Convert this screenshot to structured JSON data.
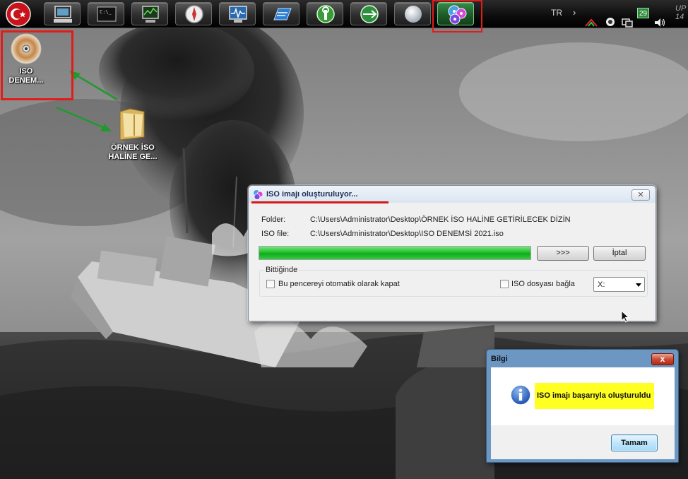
{
  "dock": {
    "items": [
      "start",
      "computer",
      "terminal",
      "system-monitor",
      "compass",
      "performance",
      "launch",
      "tools",
      "network",
      "ball",
      "iso-burner"
    ],
    "active_item": "iso-burner"
  },
  "tray": {
    "language": "TR",
    "badge_count": "29",
    "clock_line1": "UP",
    "clock_line2": "14"
  },
  "desktop": {
    "iso_icon_label_1": "ISO",
    "iso_icon_label_2": "DENEM...",
    "folder_label_1": "ÖRNEK İSO",
    "folder_label_2": "HALİNE GE..."
  },
  "iso_window": {
    "title": "ISO imajı oluşturuluyor...",
    "folder_label": "Folder:",
    "folder_value": "C:\\Users\\Administrator\\Desktop\\ÖRNEK İSO HALİNE GETİRİLECEK DİZİN",
    "iso_file_label": "ISO file:",
    "iso_file_value": "C:\\Users\\Administrator\\Desktop\\ISO DENEMSİ 2021.iso",
    "progress": 1.0,
    "more_button": ">>>",
    "cancel_button": "İptal",
    "group_label": "Bittiğinde",
    "auto_close_label": "Bu pencereyi otomatik olarak kapat",
    "auto_close_checked": false,
    "mount_label": "ISO dosyası bağla",
    "mount_checked": false,
    "drive_value": "X:"
  },
  "message_box": {
    "title": "Bilgi",
    "close_label": "x",
    "message": "ISO imajı başarıyla oluşturuldu",
    "ok_button": "Tamam"
  },
  "colors": {
    "highlight": "#e21b1b",
    "progress": "#1fc12a",
    "message_highlight": "#ffff22"
  }
}
